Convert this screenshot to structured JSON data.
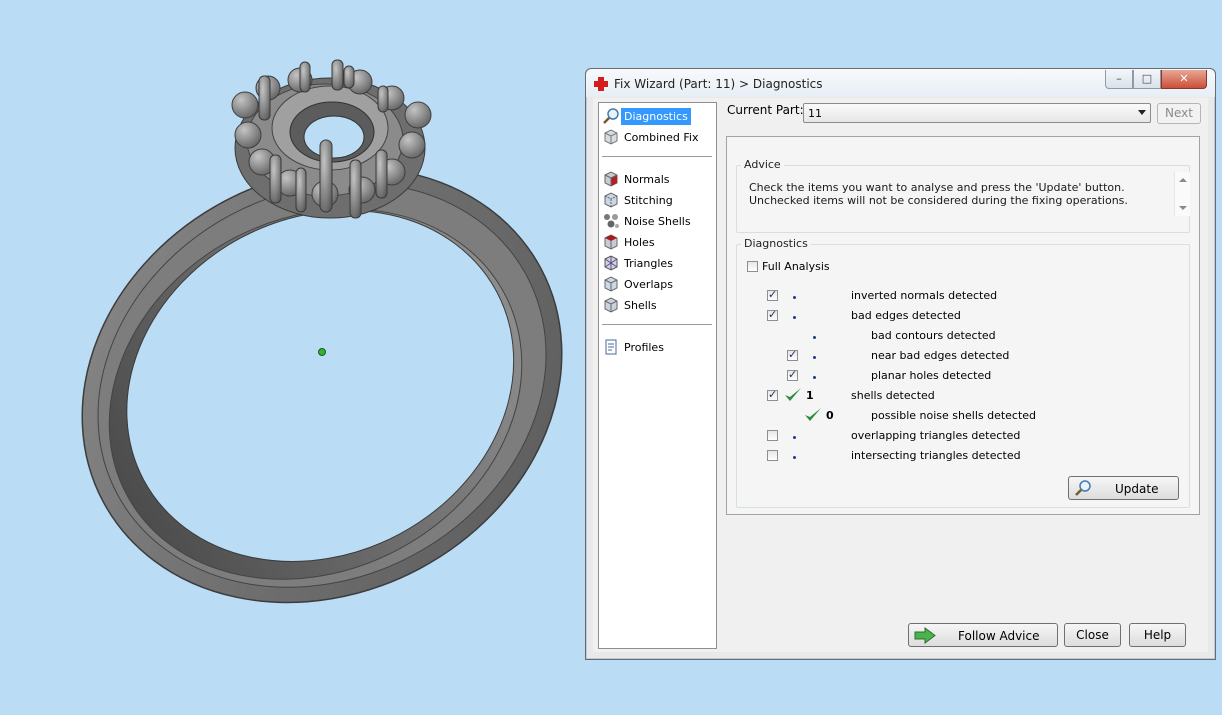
{
  "window": {
    "title": "Fix Wizard (Part: 11) > Diagnostics",
    "controls": {
      "minimize": "–",
      "maximize": "□",
      "close": "✕"
    }
  },
  "nav": {
    "items": [
      {
        "label": "Diagnostics",
        "icon": "magnifier-icon",
        "selected": true
      },
      {
        "label": "Combined Fix",
        "icon": "cube-icon"
      },
      {
        "label": "Normals",
        "icon": "normals-cube-icon"
      },
      {
        "label": "Stitching",
        "icon": "stitching-cube-icon"
      },
      {
        "label": "Noise Shells",
        "icon": "noise-shells-icon"
      },
      {
        "label": "Holes",
        "icon": "holes-cube-icon"
      },
      {
        "label": "Triangles",
        "icon": "triangles-cube-icon"
      },
      {
        "label": "Overlaps",
        "icon": "overlaps-cube-icon"
      },
      {
        "label": "Shells",
        "icon": "shells-cube-icon"
      },
      {
        "label": "Profiles",
        "icon": "document-icon"
      }
    ]
  },
  "current_part": {
    "label": "Current Part:",
    "value": "11"
  },
  "buttons": {
    "next": "Next",
    "update": "Update",
    "follow_advice": "Follow Advice",
    "close": "Close",
    "help": "Help"
  },
  "advice": {
    "title": "Advice",
    "text": "Check the items you want to analyse and press the 'Update' button. Unchecked items will not be considered during the fixing operations."
  },
  "diagnostics": {
    "title": "Diagnostics",
    "full_analysis": {
      "label": "Full Analysis",
      "checked": false
    },
    "rows": [
      {
        "label": "inverted normals detected",
        "checked": true,
        "indent": 0,
        "status": "dot"
      },
      {
        "label": "bad edges detected",
        "checked": true,
        "indent": 0,
        "status": "dot"
      },
      {
        "label": "bad contours detected",
        "checked": null,
        "indent": 1,
        "status": "dot"
      },
      {
        "label": "near bad edges detected",
        "checked": true,
        "indent": 1,
        "status": "dot"
      },
      {
        "label": "planar holes detected",
        "checked": true,
        "indent": 1,
        "status": "dot"
      },
      {
        "label": "shells detected",
        "checked": true,
        "indent": 0,
        "status": "ok",
        "count": "1"
      },
      {
        "label": "possible noise shells detected",
        "checked": null,
        "indent": 1,
        "status": "ok",
        "count": "0"
      },
      {
        "label": "overlapping triangles detected",
        "checked": false,
        "indent": 0,
        "status": "dot"
      },
      {
        "label": "intersecting triangles detected",
        "checked": false,
        "indent": 0,
        "status": "dot"
      }
    ]
  },
  "colors": {
    "background": "#bbdcf5",
    "selection": "#3399ff",
    "ok_check": "#2e8b3a",
    "model": "#7a7a7a",
    "pivot": "#2fb52f"
  }
}
